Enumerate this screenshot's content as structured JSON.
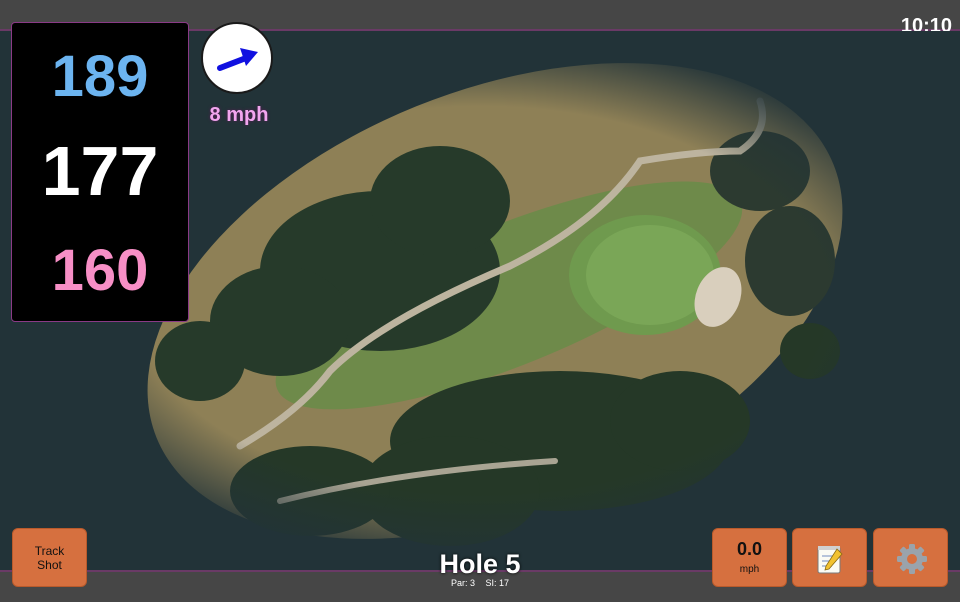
{
  "header": {
    "clock": "10:10"
  },
  "distances": {
    "back": "189",
    "middle": "177",
    "front": "160"
  },
  "wind": {
    "speed": "8 mph",
    "icon": "wind-direction-arrow-icon",
    "arrow_color": "#1010e0"
  },
  "buttons": {
    "track_shot_line1": "Track",
    "track_shot_line2": "Shot",
    "speed_value": "0.0",
    "speed_unit": "mph",
    "notes_icon": "notepad-icon",
    "settings_icon": "gear-icon"
  },
  "hole": {
    "title": "Hole 5",
    "par": "Par: 3",
    "si": "SI: 17"
  },
  "colors": {
    "back_distance": "#6cb4f0",
    "middle_distance": "#ffffff",
    "front_distance": "#f78fc6",
    "button": "#d6703f",
    "bars": "#464646",
    "bar_border": "#6a3a66"
  }
}
